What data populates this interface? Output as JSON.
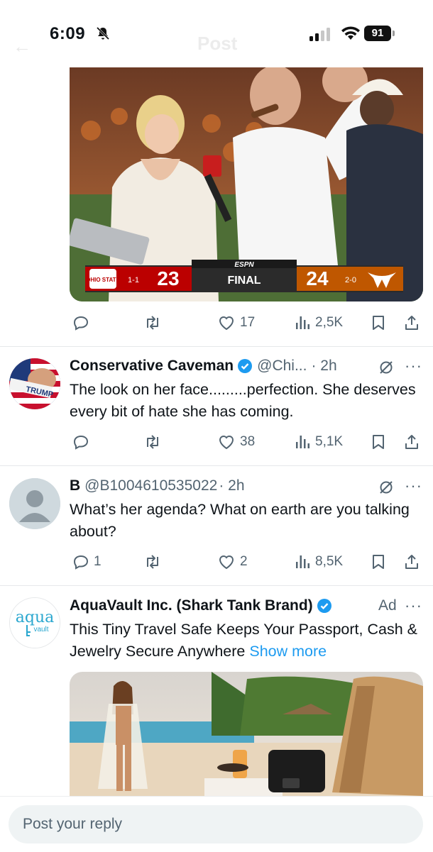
{
  "status_bar": {
    "time": "6:09",
    "battery": "91",
    "ghost_header_title": "Post"
  },
  "hero": {
    "scorebug": {
      "team_left": "OHIO STATE",
      "left_record": "1-1",
      "left_score": "23",
      "network": "ESPN",
      "status": "FINAL",
      "right_score": "24",
      "right_record": "2-0"
    }
  },
  "top_post_actions": {
    "replies": "",
    "reposts": "",
    "likes": "17",
    "views": "2,5K"
  },
  "posts": [
    {
      "name": "Conservative Caveman",
      "handle": "@Chi...",
      "time": "· 2h",
      "avatar_text": "TRUMP",
      "text": "The look on her face.........perfection. She deserves every bit of hate she has coming.",
      "actions": {
        "replies": "",
        "reposts": "",
        "likes": "38",
        "views": "5,1K"
      }
    },
    {
      "name": "B",
      "handle": "@B1004610535022",
      "time": "· 2h",
      "text": "What’s her agenda? What on earth are you talking about?",
      "actions": {
        "replies": "1",
        "reposts": "",
        "likes": "2",
        "views": "8,5K"
      }
    },
    {
      "name": "AquaVault Inc. (Shark Tank Brand)",
      "ad_label": "Ad",
      "avatar_text": "aqua",
      "avatar_subtext": "vault",
      "text": "This Tiny Travel Safe Keeps Your Passport, Cash & Jewelry Secure Anywhere",
      "show_more": "Show more"
    }
  ],
  "reply": {
    "placeholder": "Post your reply"
  },
  "colors": {
    "accent": "#1d9bf0",
    "muted": "#536471",
    "divider": "#e6e8ea",
    "text": "#0f1419"
  },
  "icons": [
    "bell-slash-icon",
    "signal-icon",
    "wifi-icon",
    "reply-icon",
    "repost-icon",
    "like-icon",
    "views-icon",
    "bookmark-icon",
    "share-icon",
    "verified-icon",
    "grok-icon",
    "more-icon"
  ]
}
